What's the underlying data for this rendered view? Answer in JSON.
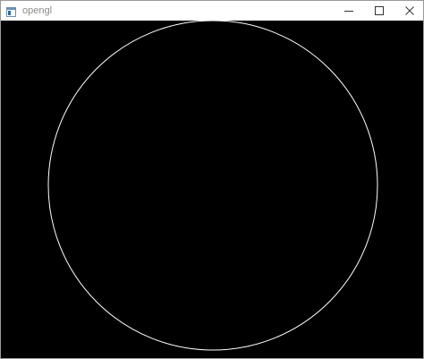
{
  "window": {
    "title": "opengl",
    "icon": "app-window-icon",
    "controls": [
      "minimize-icon",
      "maximize-icon",
      "close-icon"
    ]
  },
  "viewport": {
    "background": "#000000",
    "shape": "circle-outline",
    "stroke_color": "#ffffff"
  }
}
